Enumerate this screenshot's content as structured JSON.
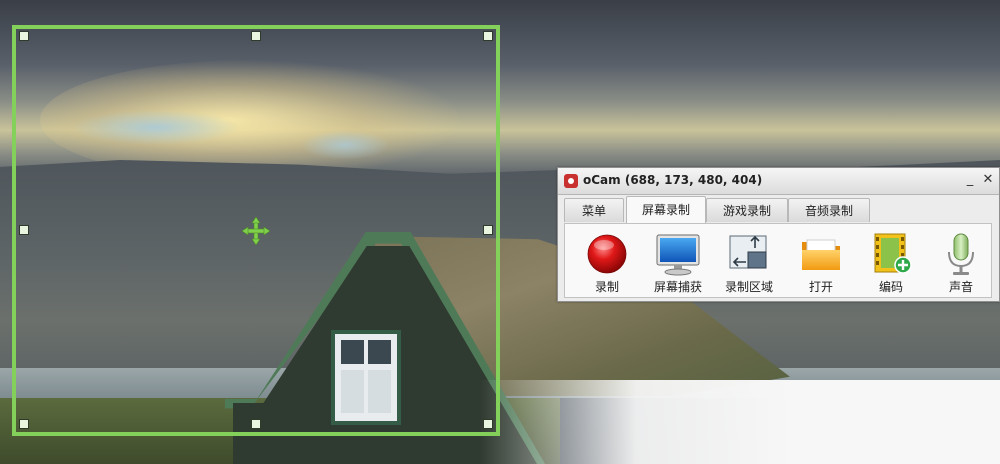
{
  "window": {
    "title": "oCam (688, 173, 480, 404)",
    "minimize_glyph": "_",
    "close_glyph": "✕"
  },
  "tabs": [
    {
      "label": "菜单",
      "active": false
    },
    {
      "label": "屏幕录制",
      "active": true
    },
    {
      "label": "游戏录制",
      "active": false
    },
    {
      "label": "音频录制",
      "active": false
    }
  ],
  "tools": [
    {
      "label": "录制",
      "icon": "record-icon"
    },
    {
      "label": "屏幕捕获",
      "icon": "monitor-icon"
    },
    {
      "label": "录制区域",
      "icon": "region-icon"
    },
    {
      "label": "打开",
      "icon": "folder-icon"
    },
    {
      "label": "编码",
      "icon": "film-add-icon"
    },
    {
      "label": "声音",
      "icon": "microphone-icon"
    }
  ],
  "colors": {
    "selection_border": "#83d05a",
    "record_red": "#e01818"
  }
}
